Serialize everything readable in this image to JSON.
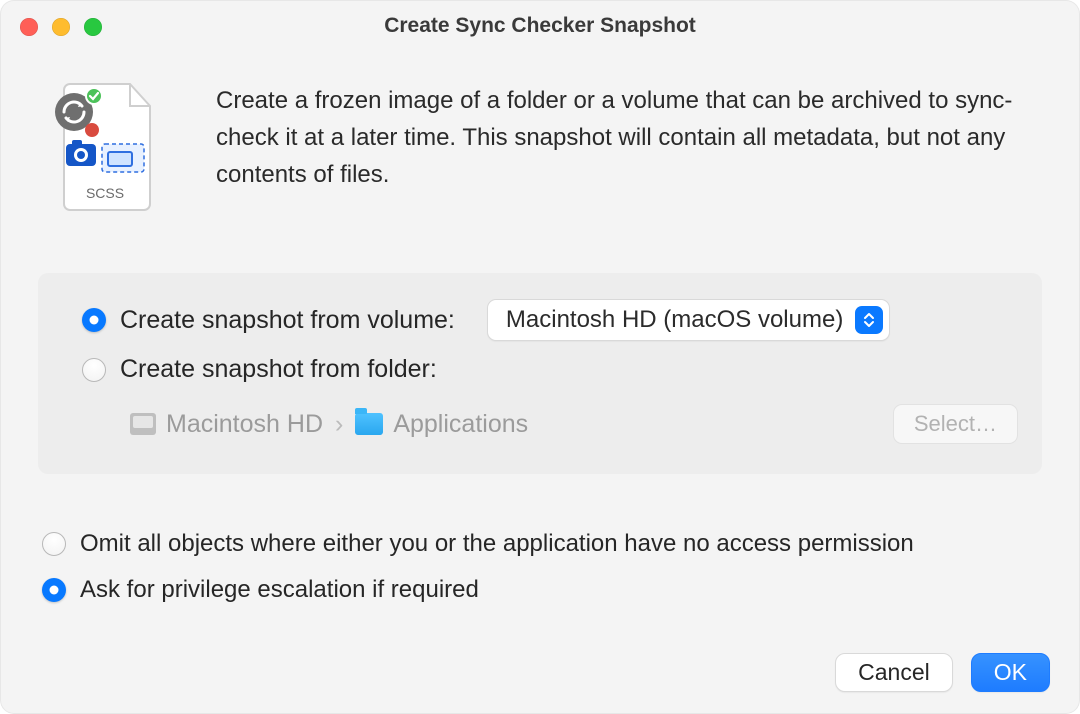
{
  "window": {
    "title": "Create Sync Checker Snapshot"
  },
  "intro": {
    "icon_badge": "SCSS",
    "text": "Create a frozen image of a folder or a volume that can be archived to sync-check it at a later time. This snapshot will contain all metadata, but not any contents of files."
  },
  "options": {
    "from_volume": {
      "label": "Create snapshot from volume:",
      "selected": true,
      "volume_display": "Macintosh HD (macOS volume)"
    },
    "from_folder": {
      "label": "Create snapshot from folder:",
      "selected": false,
      "path_root": "Macintosh HD",
      "path_item": "Applications",
      "select_button": "Select…"
    }
  },
  "checks": {
    "omit_no_access": {
      "label": "Omit all objects where either you or the application have no access permission",
      "selected": false
    },
    "ask_escalation": {
      "label": "Ask for privilege escalation if required",
      "selected": true
    }
  },
  "footer": {
    "cancel": "Cancel",
    "ok": "OK"
  }
}
